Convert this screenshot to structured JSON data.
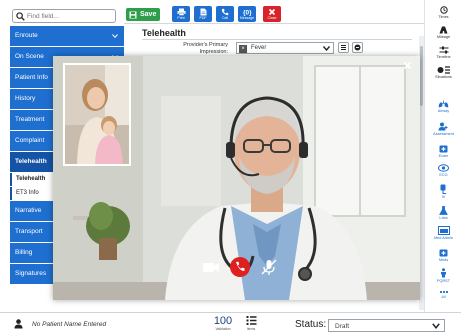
{
  "search": {
    "placeholder": "Find field..."
  },
  "toolbar": {
    "save_label": "Save",
    "buttons": [
      {
        "label": "Print",
        "icon": "printer-icon"
      },
      {
        "label": "PDF",
        "icon": "document-icon"
      },
      {
        "label": "Call",
        "icon": "phone-icon"
      },
      {
        "label": "Message",
        "icon": "message-icon"
      },
      {
        "label": "Close",
        "icon": "close-icon"
      }
    ]
  },
  "sidebar": {
    "items": [
      {
        "label": "Enroute"
      },
      {
        "label": "On Scene"
      },
      {
        "label": "Patient Info"
      },
      {
        "label": "History"
      },
      {
        "label": "Treatment"
      },
      {
        "label": "Complaint"
      },
      {
        "label": "Telehealth"
      },
      {
        "label": "Narrative"
      },
      {
        "label": "Transport"
      },
      {
        "label": "Billing"
      },
      {
        "label": "Signatures"
      }
    ],
    "subitems": [
      {
        "label": "Telehealth"
      },
      {
        "label": "ET3 Info"
      }
    ]
  },
  "form": {
    "section_title": "Telehealth",
    "provider_label": "Provider's Primary Impression:",
    "provider_value": "Fever"
  },
  "rail": {
    "items": [
      {
        "label": "Times",
        "icon": "clock-icon"
      },
      {
        "label": "Mileage",
        "icon": "road-icon"
      },
      {
        "label": "Timeline",
        "icon": "timeline-icon"
      },
      {
        "label": "Situations",
        "icon": "situations-icon"
      },
      {
        "label": "Airway",
        "icon": "lungs-icon"
      },
      {
        "label": "Assessment",
        "icon": "assessment-icon"
      },
      {
        "label": "Exam",
        "icon": "exam-icon"
      },
      {
        "label": "ECG",
        "icon": "ecg-icon"
      },
      {
        "label": "IV",
        "icon": "iv-icon"
      },
      {
        "label": "Labs",
        "icon": "labs-icon"
      },
      {
        "label": "Med Admin",
        "icon": "medication-icon"
      },
      {
        "label": "Meds",
        "icon": "meds-icon"
      },
      {
        "label": "PQRST",
        "icon": "person-icon"
      },
      {
        "label": "All",
        "icon": "more-icon"
      }
    ]
  },
  "video_call": {
    "controls": [
      "camera-icon",
      "end-call-icon",
      "mute-microphone-icon"
    ]
  },
  "footer": {
    "patient_name": "No Patient Name Entered",
    "validation_count": "100",
    "validation_label": "Validation",
    "items_label": "Items",
    "status_label": "Status:",
    "status_value": "Draft"
  },
  "colors": {
    "nav_blue": "#1e6fd0",
    "nav_active": "#1553a6",
    "save_green": "#2e9e4a",
    "close_red": "#d8232a",
    "end_call_red": "#e02020"
  }
}
